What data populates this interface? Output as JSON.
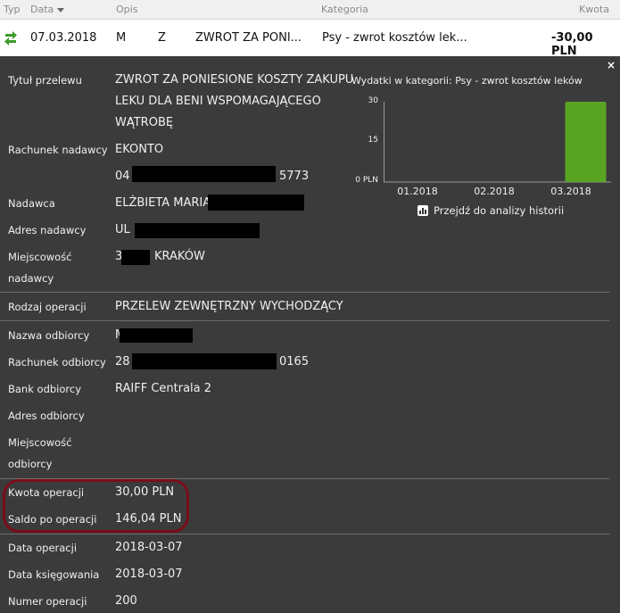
{
  "header": {
    "col_type": "Typ",
    "col_date": "Data",
    "col_desc": "Opis",
    "col_category": "Kategoria",
    "col_amount": "Kwota"
  },
  "row": {
    "date": "07.03.2018",
    "desc_a": "M",
    "desc_b": "Z",
    "desc_c": "ZWROT ZA PONI...",
    "category": "Psy - zwrot kosztów lek...",
    "amount": "-30,00 PLN"
  },
  "details": {
    "title_label": "Tytuł przelewu",
    "title_lines": [
      "ZWROT ZA PONIESIONE KOSZTY ZAKUPU",
      "LEKU DLA BENI WSPOMAGAJĄCEGO",
      "WĄTROBĘ"
    ],
    "sender_account_label": "Rachunek nadawcy",
    "sender_account_name": "EKONTO",
    "sender_account_start": "04",
    "sender_account_end": "5773",
    "sender_label": "Nadawca",
    "sender_value": "ELŻBIETA MARIA M",
    "sender_address_label": "Adres nadawcy",
    "sender_address_value": "UL",
    "sender_city_label_1": "Miejscowość",
    "sender_city_label_2": "nadawcy",
    "sender_city_prefix": "3",
    "sender_city_value": "KRAKÓW",
    "op_type_label": "Rodzaj operacji",
    "op_type_value": "PRZELEW ZEWNĘTRZNY WYCHODZĄCY",
    "recipient_name_label": "Nazwa odbiorcy",
    "recipient_name_prefix": "M",
    "recipient_account_label": "Rachunek odbiorcy",
    "recipient_account_start": "28",
    "recipient_account_end": "0165",
    "recipient_bank_label": "Bank odbiorcy",
    "recipient_bank_value": "RAIFF Centrala 2",
    "recipient_address_label": "Adres odbiorcy",
    "recipient_city_label_1": "Miejscowość",
    "recipient_city_label_2": "odbiorcy",
    "amount_label": "Kwota operacji",
    "amount_value": "30,00 PLN",
    "balance_label": "Saldo po operacji",
    "balance_value": "146,04 PLN",
    "op_date_label": "Data operacji",
    "op_date_value": "2018-03-07",
    "booking_date_label": "Data księgowania",
    "booking_date_value": "2018-03-07",
    "op_number_label": "Numer operacji",
    "op_number_value": "200"
  },
  "chart_link": "Przejdź do analizy historii",
  "close": "×",
  "colors": {
    "bar": "#5aa424",
    "panel": "#3b3b3b",
    "highlight_ring": "#7b0d1a",
    "icon_green": "#3f9a2a"
  },
  "chart_data": {
    "type": "bar",
    "title": "Wydatki w kategorii:  Psy - zwrot kosztów leków",
    "categories": [
      "01.2018",
      "02.2018",
      "03.2018"
    ],
    "values": [
      0,
      0,
      30
    ],
    "ylim": [
      0,
      30
    ],
    "yticks": [
      "30",
      "15",
      "0 PLN"
    ],
    "grid": false
  }
}
